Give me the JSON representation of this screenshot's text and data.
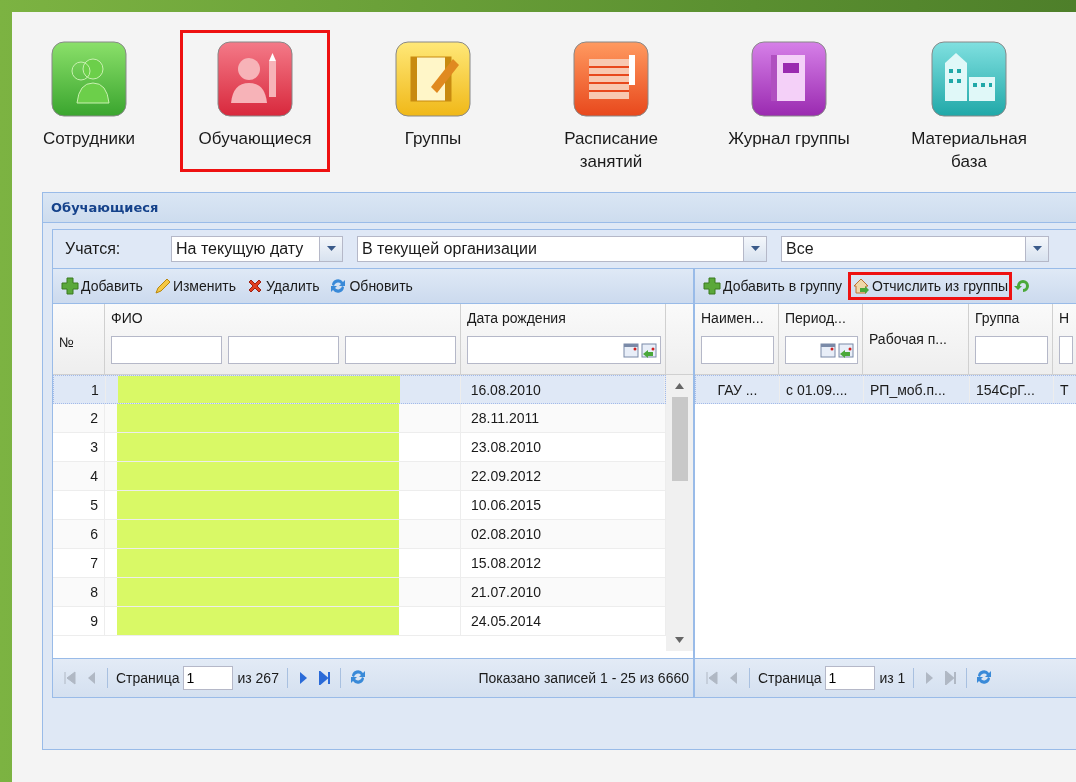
{
  "nav": [
    {
      "label": "Сотрудники",
      "selected": false
    },
    {
      "label": "Обучающиеся",
      "selected": true
    },
    {
      "label": "Группы",
      "selected": false
    },
    {
      "label": "Расписание занятий",
      "selected": false
    },
    {
      "label": "Журнал группы",
      "selected": false
    },
    {
      "label": "Материальная база",
      "selected": false
    }
  ],
  "panel": {
    "title": "Обучающиеся",
    "filter": {
      "label": "Учатся:",
      "selects": [
        {
          "value": "На текущую дату"
        },
        {
          "value": "В текущей организации"
        },
        {
          "value": "Все"
        }
      ]
    },
    "left": {
      "toolbar": [
        {
          "label": "Добавить",
          "highlighted": false
        },
        {
          "label": "Изменить",
          "highlighted": false
        },
        {
          "label": "Удалить",
          "highlighted": false
        },
        {
          "label": "Обновить",
          "highlighted": false
        }
      ],
      "columns": [
        {
          "title": "№"
        },
        {
          "title": "ФИО"
        },
        {
          "title": "Дата рождения"
        }
      ],
      "rows": [
        {
          "number": "1",
          "birth_date": "16.08.2010",
          "selected": true
        },
        {
          "number": "2",
          "birth_date": "28.11.2011",
          "selected": false
        },
        {
          "number": "3",
          "birth_date": "23.08.2010",
          "selected": false
        },
        {
          "number": "4",
          "birth_date": "22.09.2012",
          "selected": false
        },
        {
          "number": "5",
          "birth_date": "10.06.2015",
          "selected": false
        },
        {
          "number": "6",
          "birth_date": "02.08.2010",
          "selected": false
        },
        {
          "number": "7",
          "birth_date": "15.08.2012",
          "selected": false
        },
        {
          "number": "8",
          "birth_date": "21.07.2010",
          "selected": false
        },
        {
          "number": "9",
          "birth_date": "24.05.2014",
          "selected": false
        }
      ],
      "paging": {
        "page_label": "Страница",
        "page": "1",
        "of": "из 267",
        "summary": "Показано записей 1 - 25 из 6660"
      }
    },
    "right": {
      "toolbar": [
        {
          "label": "Добавить в группу",
          "highlighted": false
        },
        {
          "label": "Отчислить из группы",
          "highlighted": true
        }
      ],
      "columns": [
        {
          "title": "Наимен...",
          "kind": "text"
        },
        {
          "title": "Период...",
          "kind": "date"
        },
        {
          "title": "Рабочая п...",
          "kind": "plain"
        },
        {
          "title": "Группа",
          "kind": "text"
        },
        {
          "title": "Н",
          "kind": "text"
        }
      ],
      "rows": [
        {
          "cells": [
            "ГАУ ...",
            "с 01.09....",
            "РП_моб.п...",
            "154СрГ...",
            "Т"
          ],
          "selected": true
        }
      ],
      "paging": {
        "page_label": "Страница",
        "page": "1",
        "of": "из 1"
      }
    }
  }
}
